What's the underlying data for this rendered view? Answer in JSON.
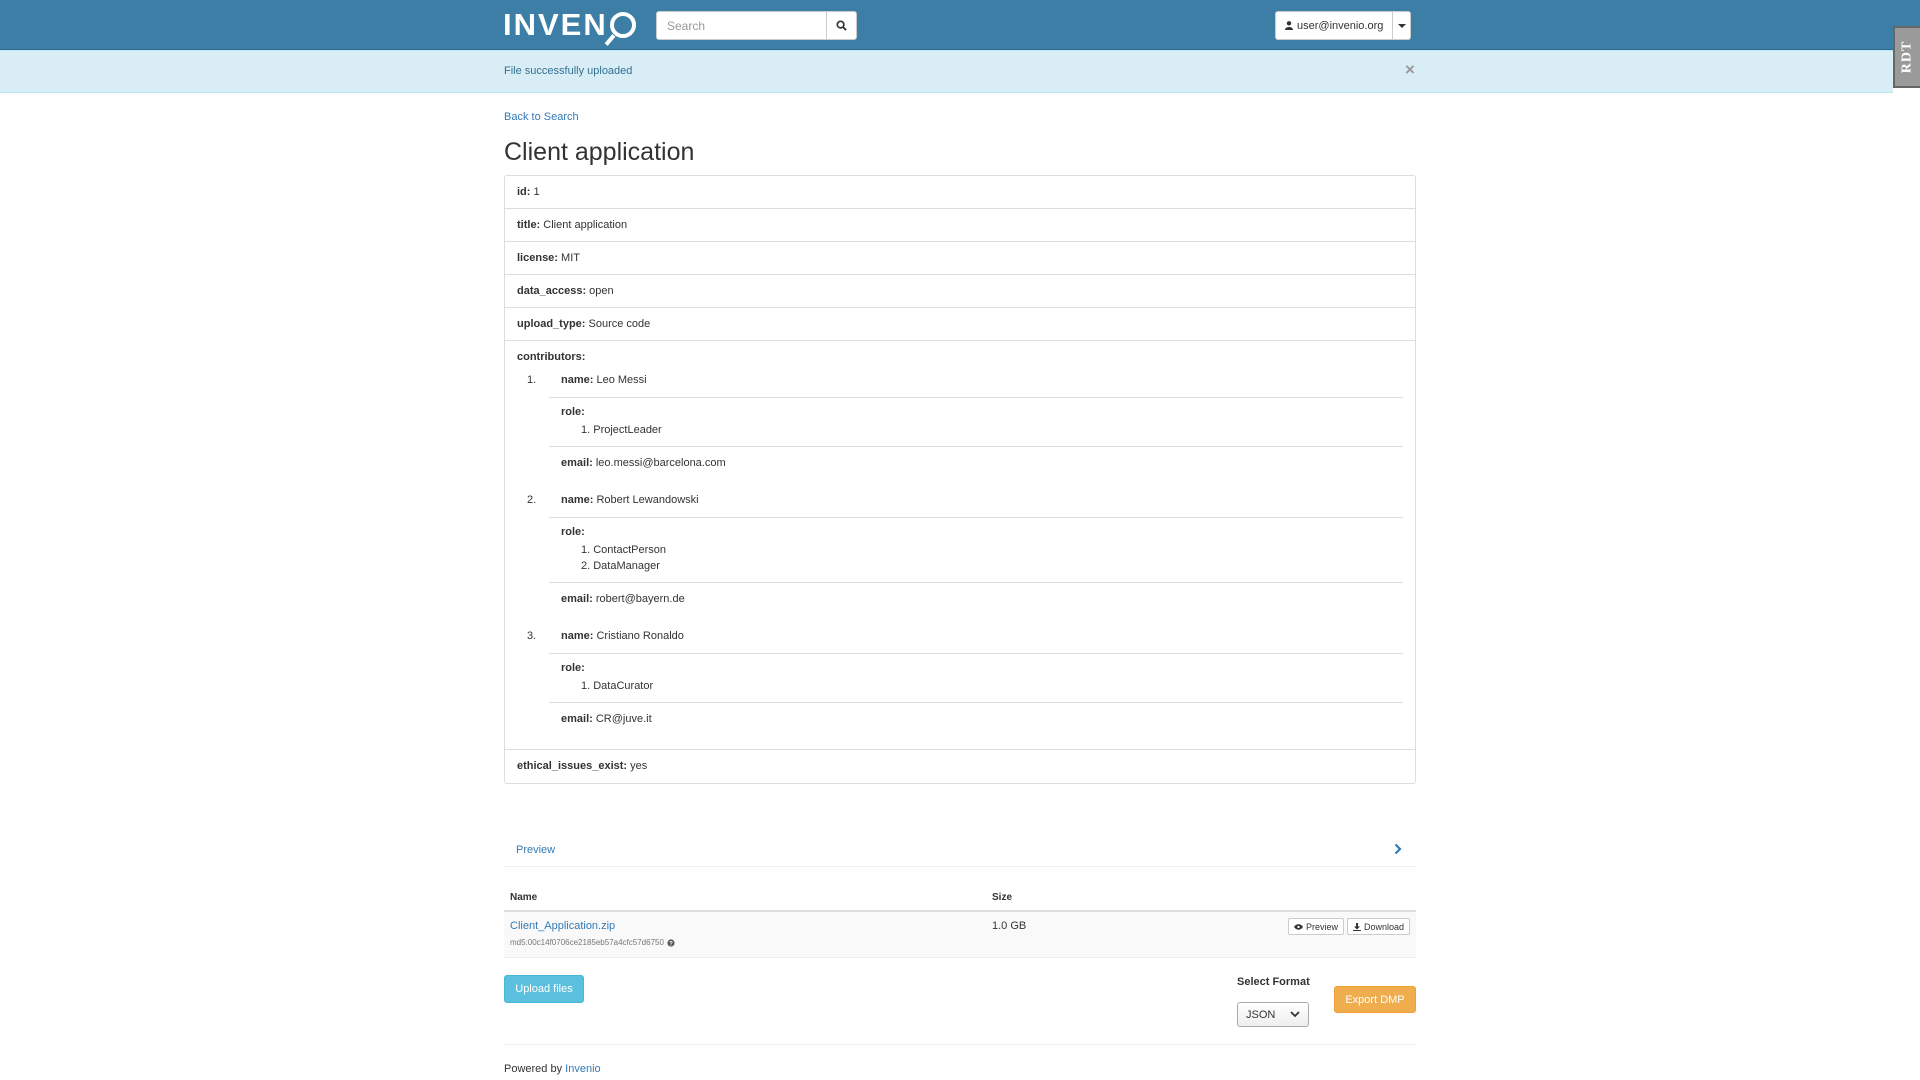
{
  "navbar": {
    "logo_text": "INVEN",
    "search_placeholder": "Search",
    "user_email": "user@invenio.org",
    "icons": {
      "search": "search-icon",
      "user": "user-icon",
      "caret": "caret-down-icon"
    }
  },
  "side_tab": {
    "label": "RDT"
  },
  "alert": {
    "message": "File successfully uploaded",
    "close": "×"
  },
  "breadcrumb": {
    "back_label": "Back to Search"
  },
  "record": {
    "title": "Client application",
    "fields": [
      {
        "key": "id:",
        "value": "1"
      },
      {
        "key": "title:",
        "value": "Client application"
      },
      {
        "key": "license:",
        "value": "MIT"
      },
      {
        "key": "data_access:",
        "value": "open"
      },
      {
        "key": "upload_type:",
        "value": "Source code"
      }
    ],
    "contributors_label": "contributors:",
    "contributors": [
      {
        "num": "1.",
        "name_key": "name:",
        "name": "Leo Messi",
        "role_key": "role:",
        "roles": [
          "1. ProjectLeader"
        ],
        "email_key": "email:",
        "email": "leo.messi@barcelona.com"
      },
      {
        "num": "2.",
        "name_key": "name:",
        "name": "Robert Lewandowski",
        "role_key": "role:",
        "roles": [
          "1. ContactPerson",
          "2. DataManager"
        ],
        "email_key": "email:",
        "email": "robert@bayern.de"
      },
      {
        "num": "3.",
        "name_key": "name:",
        "name": "Cristiano Ronaldo",
        "role_key": "role:",
        "roles": [
          "1. DataCurator"
        ],
        "email_key": "email:",
        "email": "CR@juve.it"
      }
    ],
    "ethical": {
      "key": "ethical_issues_exist:",
      "value": "yes"
    }
  },
  "preview": {
    "label": "Preview"
  },
  "files": {
    "headers": {
      "name": "Name",
      "size": "Size"
    },
    "rows": [
      {
        "name": "Client_Application.zip",
        "md5": "md5:00c14f0706ce2185eb57a4cfc57d6750",
        "size": "1.0 GB",
        "preview_label": "Preview",
        "download_label": "Download"
      }
    ]
  },
  "actions": {
    "upload_label": "Upload files",
    "format_label": "Select Format",
    "format_value": "JSON",
    "export_label": "Export DMP"
  },
  "footer": {
    "powered_by": "Powered by",
    "link": "Invenio"
  },
  "colors": {
    "navbar": "#3d7ea6",
    "alert_bg": "#d9edf7",
    "link": "#337ab7",
    "upload": "#5bc0de",
    "export": "#f0ad4e"
  }
}
